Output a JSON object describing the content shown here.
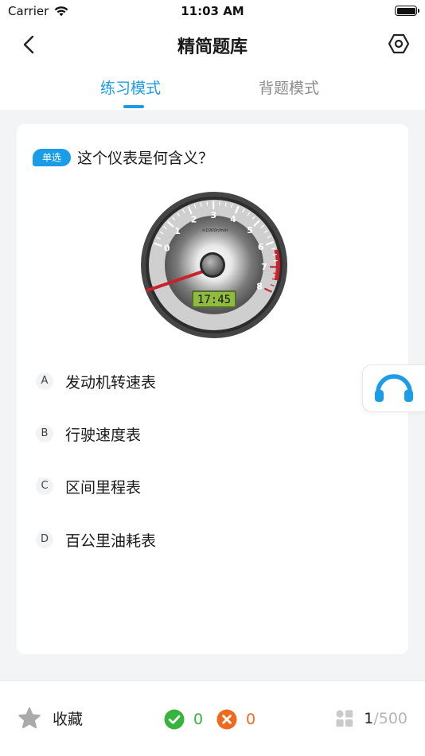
{
  "status_bar": {
    "carrier": "Carrier",
    "time": "11:03 AM"
  },
  "nav": {
    "title": "精简题库",
    "back_icon": "chevron-left-icon",
    "settings_icon": "hexagon-settings-icon"
  },
  "tabs": [
    {
      "label": "练习模式",
      "active": true
    },
    {
      "label": "背题模式",
      "active": false
    }
  ],
  "question": {
    "type": "单选",
    "text": "这个仪表是何含义？",
    "image": {
      "kind": "tachometer",
      "scale_label": "×1000r/min",
      "display_time": "17:45",
      "dial_numbers": [
        "0",
        "1",
        "2",
        "3",
        "4",
        "5",
        "6",
        "7",
        "8"
      ]
    },
    "options": [
      {
        "letter": "A",
        "text": "发动机转速表"
      },
      {
        "letter": "B",
        "text": "行驶速度表"
      },
      {
        "letter": "C",
        "text": "区间里程表"
      },
      {
        "letter": "D",
        "text": "百公里油耗表"
      }
    ]
  },
  "audio_icon": "headphones-icon",
  "bottom": {
    "favorite_label": "收藏",
    "favorite_icon": "star-icon",
    "correct_count": "0",
    "wrong_count": "0",
    "progress_current": "1",
    "progress_separator": "/",
    "progress_total": "500"
  },
  "colors": {
    "accent": "#1a9ce8",
    "correct": "#36b53e",
    "wrong": "#ef6a1f",
    "background": "#f3f4f6"
  }
}
